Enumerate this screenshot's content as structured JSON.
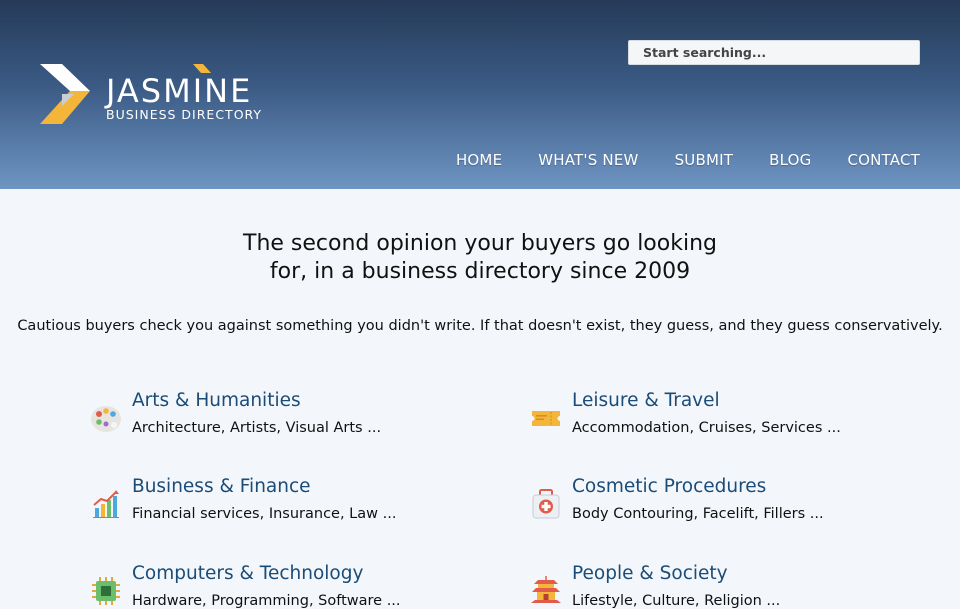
{
  "header": {
    "brand_name": "JASMINE",
    "brand_subtitle": "BUSINESS DIRECTORY",
    "search_placeholder": "Start searching...",
    "nav": [
      "HOME",
      "WHAT'S NEW",
      "SUBMIT",
      "BLOG",
      "CONTACT"
    ]
  },
  "hero": {
    "title_line1": "The second opinion your buyers go looking",
    "title_line2": "for, in a business directory since 2009",
    "tagline": "Cautious buyers check you against something you didn't write. If that doesn't exist, they guess, and they guess conservatively."
  },
  "categories": [
    {
      "title": "Arts & Humanities",
      "subs": "Architecture, Artists, Visual Arts ...",
      "icon": "palette-icon"
    },
    {
      "title": "Leisure & Travel",
      "subs": "Accommodation, Cruises, Services ...",
      "icon": "ticket-icon"
    },
    {
      "title": "Business & Finance",
      "subs": "Financial services, Insurance, Law ...",
      "icon": "chart-icon"
    },
    {
      "title": "Cosmetic Procedures",
      "subs": "Body Contouring, Facelift, Fillers ...",
      "icon": "first-aid-icon"
    },
    {
      "title": "Computers & Technology",
      "subs": "Hardware, Programming, Software ...",
      "icon": "chip-icon"
    },
    {
      "title": "People & Society",
      "subs": "Lifestyle, Culture, Religion ...",
      "icon": "pagoda-icon"
    }
  ],
  "colors": {
    "accent_orange": "#f4b63a",
    "link_blue": "#1b4b77"
  }
}
